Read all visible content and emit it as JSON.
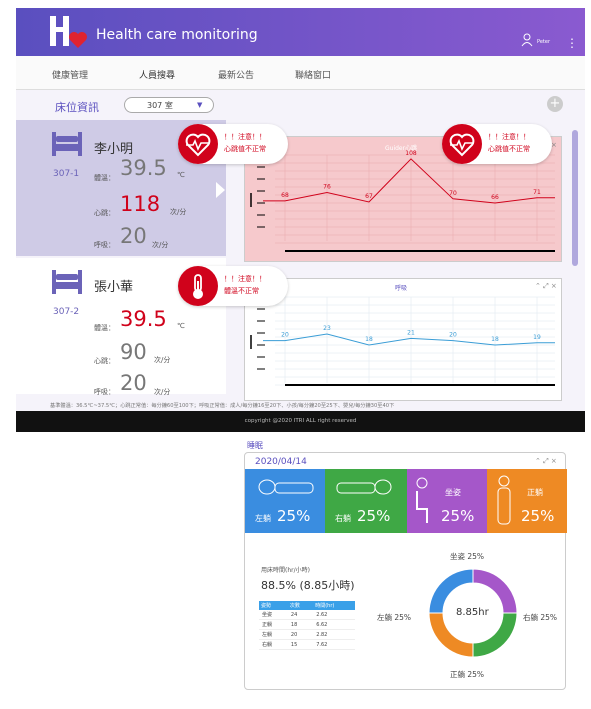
{
  "app": {
    "title": "Health care monitoring",
    "user": "Peter"
  },
  "nav": [
    "健康管理",
    "人員搜尋",
    "最新公告",
    "聯絡窗口"
  ],
  "sub": {
    "label": "床位資訊",
    "room": "307 室"
  },
  "colors": {
    "primary": "#5a4fbf",
    "alert": "#d0021b"
  },
  "beds": [
    {
      "num": "307-1",
      "name": "李小明",
      "temp_label": "體溫：",
      "temp": "39.5",
      "temp_unit": "℃",
      "hr_label": "心跳：",
      "hr": "118",
      "hr_unit": "次/分",
      "resp_label": "呼吸：",
      "resp": "20",
      "resp_unit": "次/分"
    },
    {
      "num": "307-2",
      "name": "張小華",
      "temp_label": "體溫：",
      "temp": "39.5",
      "temp_unit": "℃",
      "hr_label": "心跳：",
      "hr": "90",
      "hr_unit": "次/分",
      "resp_label": "呼吸：",
      "resp": "20",
      "resp_unit": "次/分"
    }
  ],
  "alerts": {
    "hr1": {
      "l1": "！！注意！！",
      "l2": "心跳值不正常"
    },
    "hr2": {
      "l1": "！！注意！！",
      "l2": "心跳值不正常"
    },
    "temp": {
      "l1": "！！注意！！",
      "l2": "體溫不正常"
    }
  },
  "charts": {
    "heart": {
      "title": "Guider心跳",
      "values": [
        68,
        76,
        67,
        108,
        70,
        66,
        71
      ],
      "controls": "×"
    },
    "resp": {
      "title": "呼吸",
      "values": [
        20,
        23,
        18,
        21,
        20,
        18,
        19
      ],
      "controls": "⌃ ⤢ ×"
    }
  },
  "footnote": "基準體溫：36.5℃~37.5℃；心跳正常值：每分鐘60至100下；呼吸正常值：成人/每分鐘16至20下、小孩/每分鐘20至25下、嬰兒/每分鐘30至40下",
  "footer": "copyright @2020 ITRI ALL right reserved",
  "sleep": {
    "title": "睡眠",
    "date": "2020/04/14",
    "controls": "⌃ ⤢ ×",
    "tiles": [
      {
        "label": "左躺",
        "pct": "25%",
        "color": "#3a8de0"
      },
      {
        "label": "右躺",
        "pct": "25%",
        "color": "#3fa845"
      },
      {
        "label": "坐姿",
        "pct": "25%",
        "color": "#a557c9"
      },
      {
        "label": "正躺",
        "pct": "25%",
        "color": "#ee8a24"
      }
    ],
    "stats_title": "用床時間(hr/小時)",
    "stats_value": "88.5% (8.85小時)",
    "table": {
      "headers": [
        "姿勢",
        "次數",
        "時間(hr)"
      ],
      "rows": [
        [
          "坐姿",
          "24",
          "2.62"
        ],
        [
          "正躺",
          "18",
          "6.62"
        ],
        [
          "左躺",
          "20",
          "2.82"
        ],
        [
          "右躺",
          "15",
          "7.62"
        ]
      ]
    },
    "donut": {
      "center": "8.85hr",
      "labels": {
        "top": "坐姿 25%",
        "left": "左躺 25%",
        "right": "右躺 25%",
        "bottom": "正躺 25%"
      },
      "segments": [
        {
          "name": "坐姿",
          "value": 25,
          "color": "#a557c9"
        },
        {
          "name": "右躺",
          "value": 25,
          "color": "#3fa845"
        },
        {
          "name": "正躺",
          "value": 25,
          "color": "#ee8a24"
        },
        {
          "name": "左躺",
          "value": 25,
          "color": "#3a8de0"
        }
      ]
    }
  }
}
